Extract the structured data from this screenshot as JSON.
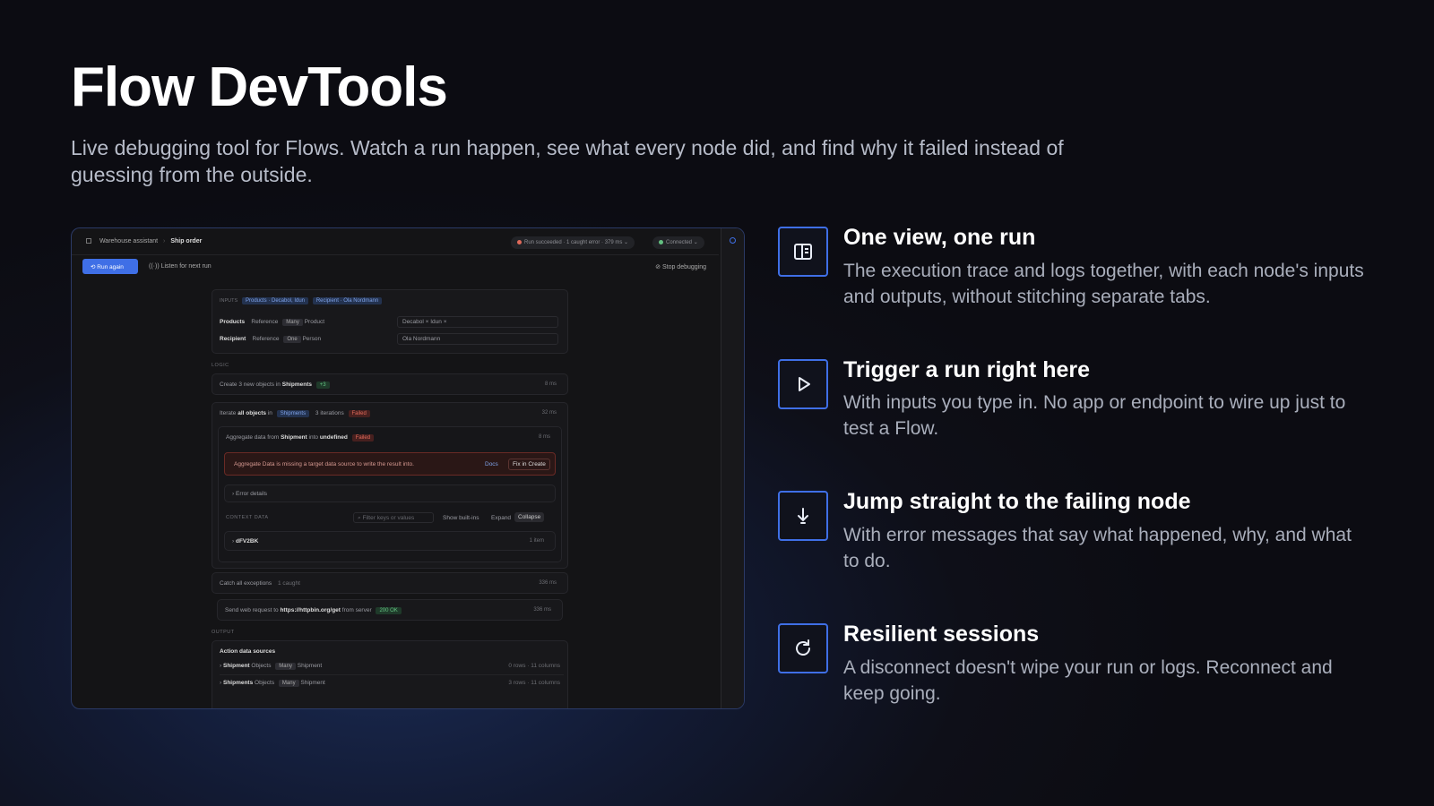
{
  "header": {
    "title": "Flow DevTools",
    "subtitle": "Live debugging tool for Flows. Watch a run happen, see what every node did, and find why it failed instead of guessing from the outside."
  },
  "screenshot": {
    "breadcrumb_app": "Warehouse assistant",
    "breadcrumb_page": "Ship order",
    "run_status": "Run succeeded · 1 caught error · 379 ms",
    "connection": "Connected",
    "run_again": "Run again",
    "listen": "Listen for next run",
    "stop_debugging": "Stop debugging",
    "inputs_label": "INPUTS",
    "input_tag_products": "Products · Decabol, Idun",
    "input_tag_recipient": "Recipient · Ola Nordmann",
    "products_label": "Products",
    "products_ref": "Reference",
    "products_many": "Many",
    "products_type": "Product",
    "products_values": "Decabol ×   Idun ×",
    "recipient_label": "Recipient",
    "recipient_ref": "Reference",
    "recipient_one": "One",
    "recipient_type": "Person",
    "recipient_value": "Ola Nordmann",
    "logic_label": "LOGIC",
    "node1_prefix": "Create 3 new objects in",
    "node1_target": "Shipments",
    "node1_tag": "+3",
    "node1_time": "8 ms",
    "node2_prefix": "Iterate",
    "node2_bold": "all objects",
    "node2_in": "in",
    "node2_target": "Shipments",
    "node2_iter": "3 iterations",
    "node2_status": "Failed",
    "node2_time": "32 ms",
    "node3_prefix": "Aggregate data from",
    "node3_source": "Shipment",
    "node3_into": "into",
    "node3_target": "undefined",
    "node3_status": "Failed",
    "node3_time": "8 ms",
    "error_message": "Aggregate Data is missing a target data source to write the result into.",
    "error_docs": "Docs",
    "error_fix": "Fix in Create",
    "error_details": "Error details",
    "context_label": "CONTEXT DATA",
    "filter_placeholder": "Filter keys or values",
    "show_builtins": "Show built-ins",
    "expand": "Expand",
    "collapse": "Collapse",
    "context_key": "dFV2BK",
    "context_meta": "1 item",
    "node4_prefix": "Catch all exceptions",
    "node4_tag": "1 caught",
    "node4_time": "336 ms",
    "node5_prefix": "Send web request to",
    "node5_url": "https://httpbin.org/get",
    "node5_suffix": "from server",
    "node5_status": "200 OK",
    "node5_time": "336 ms",
    "output_label": "OUTPUT",
    "output_title": "Action data sources",
    "out1_name": "Shipment",
    "out1_kind": "Objects",
    "out1_tag": "Many",
    "out1_type": "Shipment",
    "out1_meta": "0 rows · 11 columns",
    "out2_name": "Shipments",
    "out2_kind": "Objects",
    "out2_tag": "Many",
    "out2_type": "Shipment",
    "out2_meta": "3 rows · 11 columns"
  },
  "features": [
    {
      "icon": "panel-layout-icon",
      "title": "One view, one run",
      "desc": "The execution trace and logs together, with each node's inputs and outputs, without stitching separate tabs."
    },
    {
      "icon": "play-icon",
      "title": "Trigger a run right here",
      "desc": "With inputs you type in. No app or endpoint to wire up just to test a Flow."
    },
    {
      "icon": "arrow-down-icon",
      "title": "Jump straight to the failing node",
      "desc": "With error messages that say what happened, why, and what to do."
    },
    {
      "icon": "refresh-icon",
      "title": "Resilient sessions",
      "desc": "A disconnect doesn't wipe your run or logs. Reconnect and keep going."
    }
  ],
  "colors": {
    "accent": "#3f6fe6",
    "error": "#e06a5a",
    "success": "#63c081"
  }
}
